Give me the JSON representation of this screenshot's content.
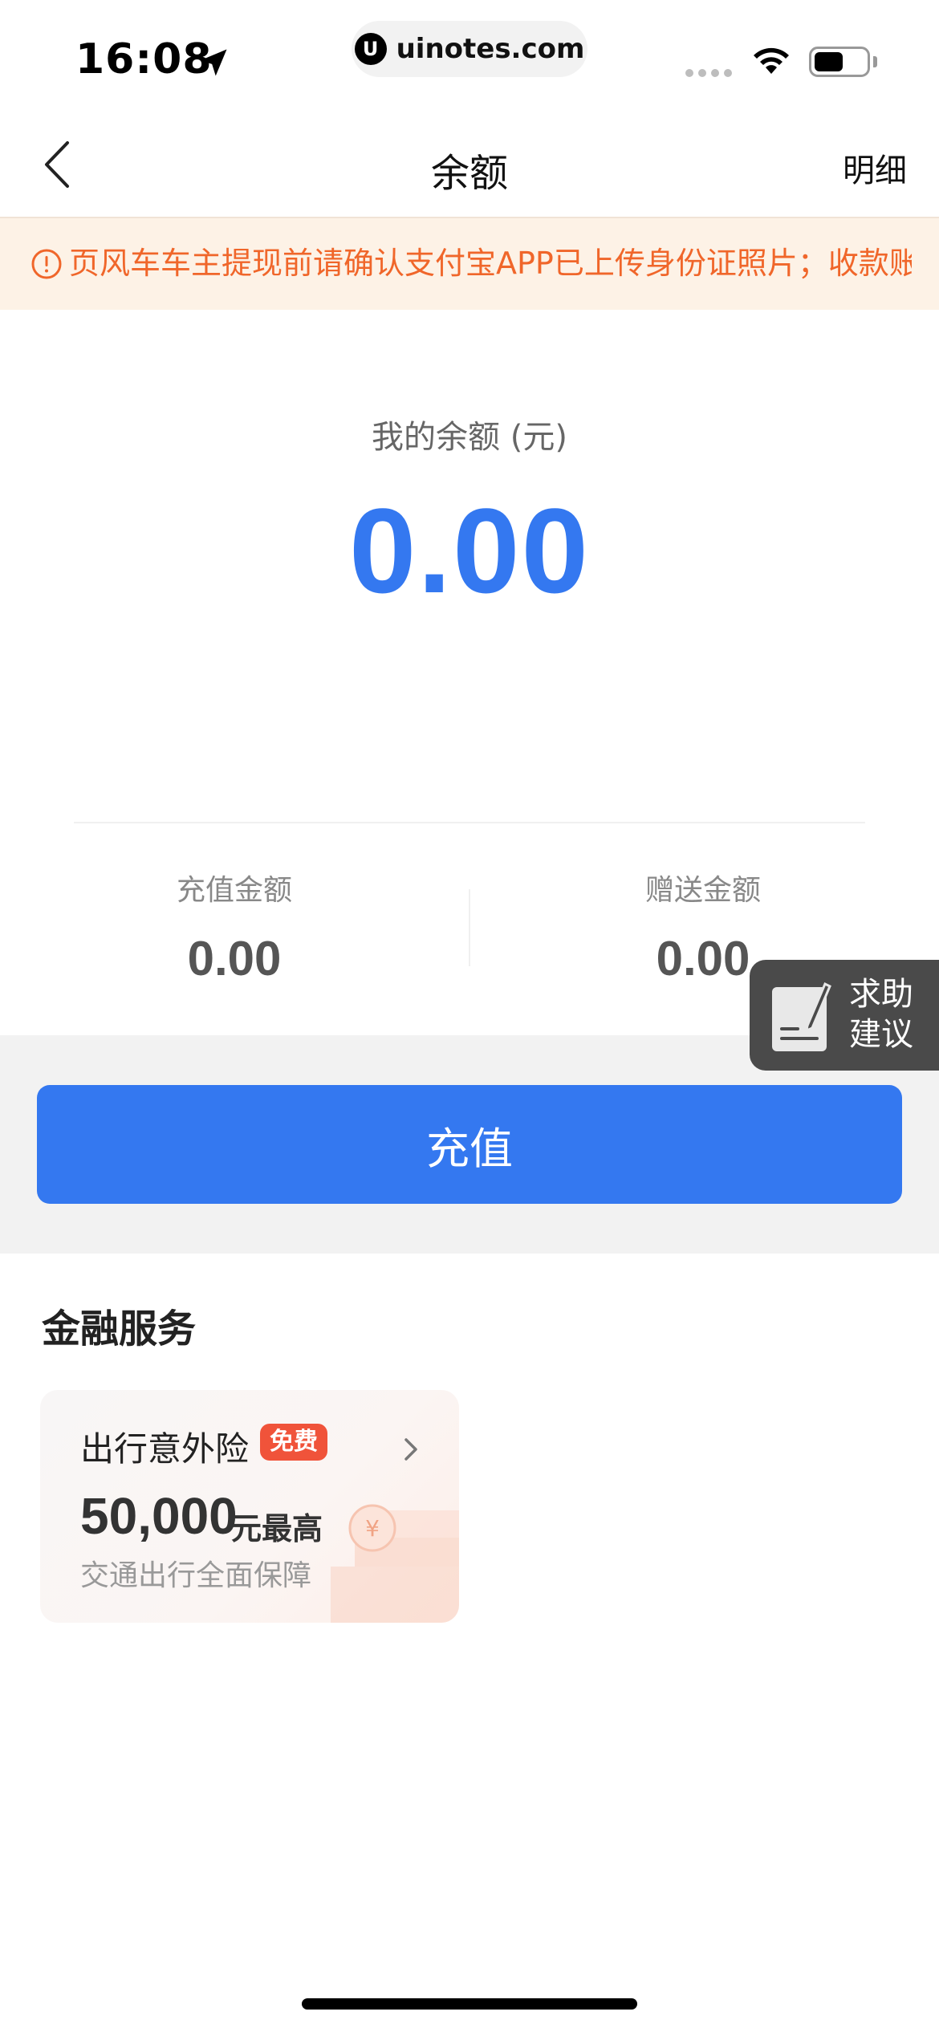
{
  "status_bar": {
    "time": "16:08",
    "url": "uinotes.com",
    "url_logo": "U",
    "battery_level": 0.55
  },
  "nav": {
    "title": "余额",
    "detail_label": "明细"
  },
  "notice": {
    "icon": "info-circle-icon",
    "text": "页风车车主提现前请确认支付宝APP已上传身份证照片；收款账"
  },
  "balance": {
    "label": "我的余额 (元)",
    "value": "0.00"
  },
  "sub_balances": [
    {
      "label": "充值金额",
      "value": "0.00"
    },
    {
      "label": "赠送金额",
      "value": "0.00"
    }
  ],
  "help_fab": {
    "line1": "求助",
    "line2": "建议"
  },
  "recharge_button": "充值",
  "finance": {
    "title": "金融服务",
    "card": {
      "title": "出行意外险",
      "badge": "免费",
      "amount": "50,000",
      "unit": "元最高",
      "description": "交通出行全面保障"
    }
  },
  "colors": {
    "accent": "#3478f0",
    "notice_text": "#f0662a",
    "notice_bg": "#fdf2e6",
    "badge": "#f0533a"
  }
}
